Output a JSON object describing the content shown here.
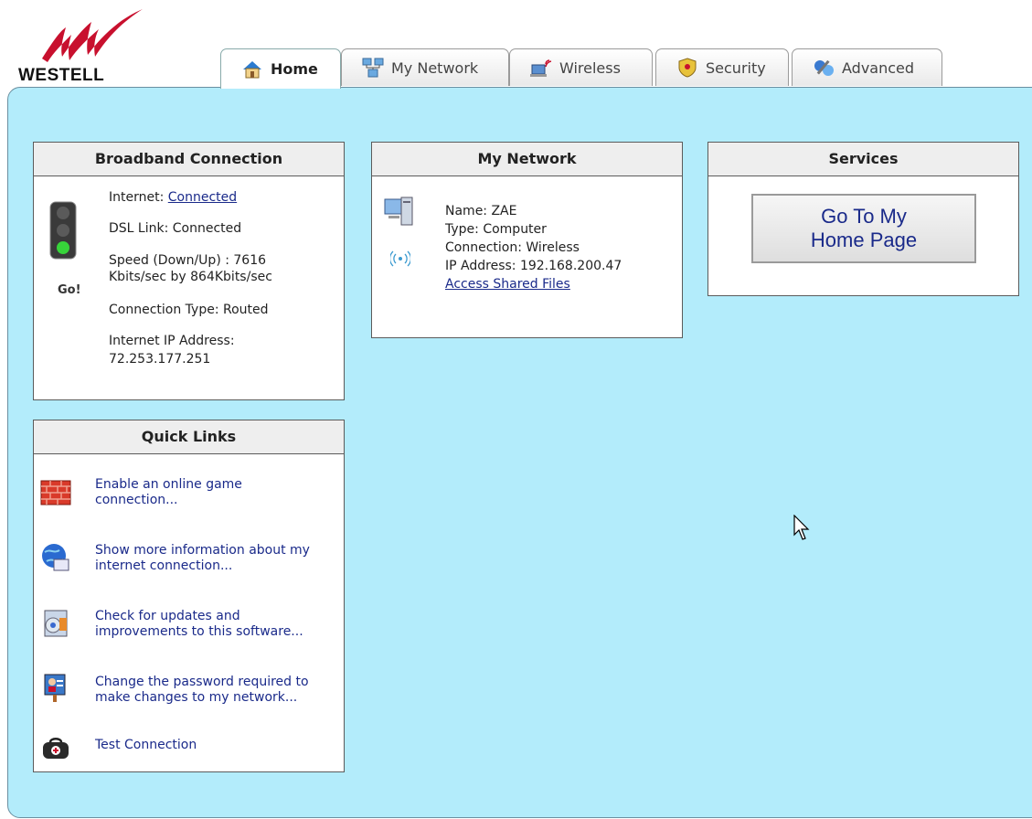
{
  "brand": {
    "name": "WESTELL"
  },
  "tabs": [
    {
      "label": "Home",
      "icon": "home-icon",
      "active": true
    },
    {
      "label": "My Network",
      "icon": "network-icon",
      "active": false
    },
    {
      "label": "Wireless",
      "icon": "wireless-icon",
      "active": false
    },
    {
      "label": "Security",
      "icon": "shield-icon",
      "active": false
    },
    {
      "label": "Advanced",
      "icon": "tools-icon",
      "active": false
    }
  ],
  "broadband": {
    "title": "Broadband Connection",
    "go_label": "Go!",
    "internet_label": "Internet:",
    "internet_value": "Connected",
    "dsl": "DSL Link: Connected",
    "speed_line1": "Speed (Down/Up) : 7616",
    "speed_line2": "Kbits/sec by 864Kbits/sec",
    "conn_type": "Connection Type: Routed",
    "ip_label": "Internet IP Address:",
    "ip_value": "72.253.177.251"
  },
  "quick_links": {
    "title": "Quick Links",
    "items": [
      {
        "line1": "Enable an online game",
        "line2": "connection...",
        "icon": "firewall-icon"
      },
      {
        "line1": "Show more information about my",
        "line2": "internet connection...",
        "icon": "globe-info-icon"
      },
      {
        "line1": "Check for updates and",
        "line2": "improvements to this software...",
        "icon": "update-disk-icon"
      },
      {
        "line1": "Change the password required to",
        "line2": "make changes to my network...",
        "icon": "password-icon"
      },
      {
        "line1": "Test Connection",
        "line2": "",
        "icon": "doctor-bag-icon"
      }
    ]
  },
  "my_network": {
    "title": "My Network",
    "name": "Name: ZAE",
    "type": "Type: Computer",
    "connection": "Connection: Wireless",
    "ip": "IP Address: 192.168.200.47",
    "share_link": "Access Shared Files"
  },
  "services": {
    "title": "Services",
    "button_line1": "Go To My",
    "button_line2": "Home Page"
  },
  "colors": {
    "panel_bg": "#b3ecfb",
    "link": "#1a2a8a",
    "logo_red": "#c8102e"
  }
}
